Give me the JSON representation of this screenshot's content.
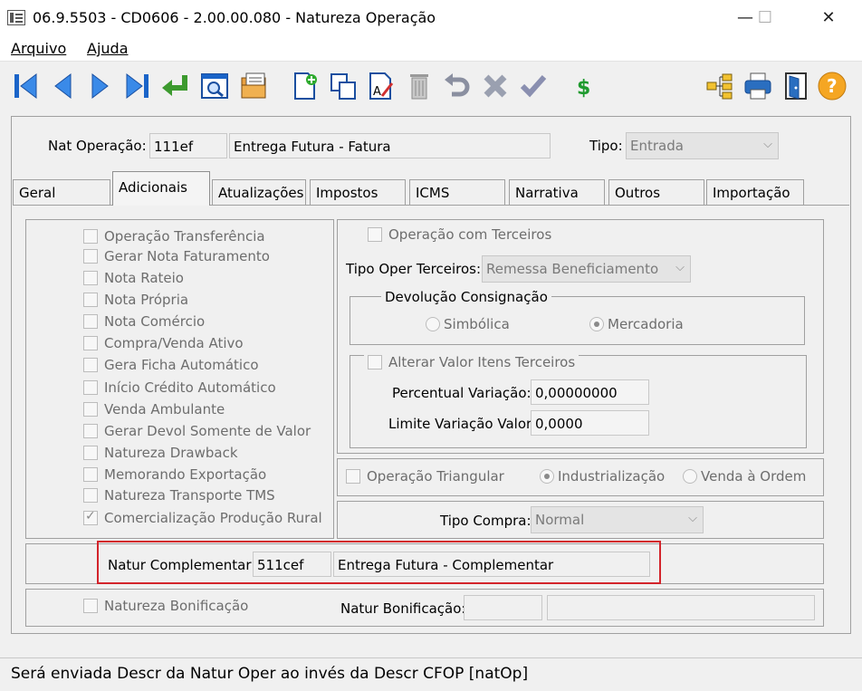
{
  "window": {
    "title": "06.9.5503 - CD0606 - 2.00.00.080 - Natureza Operação",
    "minimize": "—",
    "maximize": "☐",
    "close": "✕"
  },
  "menu": {
    "file": "Arquivo",
    "help": "Ajuda"
  },
  "header": {
    "nat_label": "Nat Operação:",
    "nat_code": "111ef",
    "nat_desc": "Entrega Futura - Fatura",
    "tipo_label": "Tipo:",
    "tipo_value": "Entrada"
  },
  "tabs": [
    "Geral",
    "Adicionais",
    "Atualizações",
    "Impostos",
    "ICMS",
    "Narrativa",
    "Outros",
    "Importação"
  ],
  "left_checks": [
    {
      "label": "Operação Transferência",
      "checked": false
    },
    {
      "label": "Gerar Nota Faturamento",
      "checked": false
    },
    {
      "label": "Nota Rateio",
      "checked": false
    },
    {
      "label": "Nota Própria",
      "checked": false
    },
    {
      "label": "Nota Comércio",
      "checked": false
    },
    {
      "label": "Compra/Venda Ativo",
      "checked": false
    },
    {
      "label": "Gera Ficha Automático",
      "checked": false
    },
    {
      "label": "Início Crédito Automático",
      "checked": false
    },
    {
      "label": "Venda Ambulante",
      "checked": false
    },
    {
      "label": "Gerar Devol Somente de Valor",
      "checked": false
    },
    {
      "label": "Natureza Drawback",
      "checked": false
    },
    {
      "label": "Memorando Exportação",
      "checked": false
    },
    {
      "label": "Natureza Transporte TMS",
      "checked": false
    },
    {
      "label": "Comercialização Produção Rural",
      "checked": true
    }
  ],
  "terceiros": {
    "op_label": "Operação com Terceiros",
    "tipo_label": "Tipo Oper Terceiros:",
    "tipo_value": "Remessa Beneficiamento",
    "devol_legend": "Devolução Consignação",
    "radio_simbolica": "Simbólica",
    "radio_mercadoria": "Mercadoria",
    "alterar_label": "Alterar Valor Itens Terceiros",
    "perc_label": "Percentual Variação:",
    "perc_value": "0,00000000",
    "limite_label": "Limite Variação Valor:",
    "limite_value": "0,0000"
  },
  "triangular": {
    "label": "Operação Triangular",
    "radio_ind": "Industrialização",
    "radio_venda": "Venda à Ordem"
  },
  "compra": {
    "label": "Tipo Compra:",
    "value": "Normal"
  },
  "complementar": {
    "label": "Natur Complementar:",
    "code": "511cef",
    "desc": "Entrega Futura - Complementar"
  },
  "bonificacao": {
    "check_label": "Natureza Bonificação",
    "label": "Natur Bonificação:"
  },
  "status": "Será enviada Descr da Natur Oper ao invés da Descr CFOP [natOp]",
  "colors": {
    "highlight": "#d3242b",
    "nav_blue": "#1a64c8",
    "help_orange": "#f5a623"
  }
}
